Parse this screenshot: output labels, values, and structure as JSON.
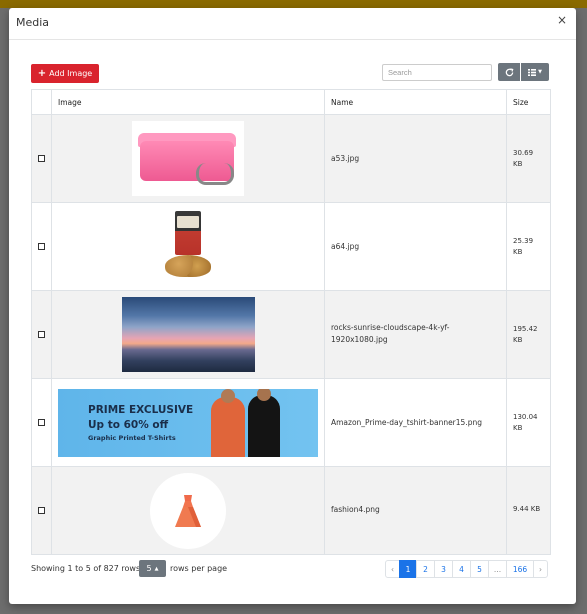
{
  "modal": {
    "title": "Media",
    "close": "×"
  },
  "toolbar": {
    "add_label": "Add Image",
    "add_icon": "+",
    "search_placeholder": "Search",
    "refresh_icon": "refresh-icon",
    "columns_icon": "columns-grid-icon"
  },
  "table": {
    "headers": [
      "",
      "Image",
      "Name",
      "Size"
    ],
    "rows": [
      {
        "name": "a53.jpg",
        "size_line1": "30.69",
        "size_line2": "KB",
        "image": "pink vanity case"
      },
      {
        "name": "a64.jpg",
        "size_line1": "25.39",
        "size_line2": "KB",
        "image": "nut snack pack"
      },
      {
        "name_line1": "rocks-sunrise-cloudscape-4k-yf-",
        "name_line2": "1920x1080.jpg",
        "size_line1": "195.42",
        "size_line2": "KB",
        "image": "sunrise seascape"
      },
      {
        "name": "Amazon_Prime-day_tshirt-banner15.png",
        "size_line1": "130.04",
        "size_line2": "KB",
        "image": "t-shirt banner"
      },
      {
        "name": "fashion4.png",
        "size_line1": "9.44 KB",
        "image": "dress icon"
      }
    ]
  },
  "banner": {
    "line1": "PRIME EXCLUSIVE",
    "line2": "Up to 60% off",
    "line3": "Graphic Printed T-Shirts"
  },
  "footer": {
    "showing": "Showing 1 to 5 of 827 rows",
    "rows_value": "5",
    "rows_caret": "▲",
    "rows_label": "rows per page"
  },
  "pagination": {
    "prev": "‹",
    "pages": [
      "1",
      "2",
      "3",
      "4",
      "5",
      "...",
      "166"
    ],
    "next": "›",
    "active_page": "1"
  },
  "colors": {
    "accent_red": "#d9232d",
    "secondary_gray": "#6c757d",
    "link_blue": "#1a73e8"
  }
}
